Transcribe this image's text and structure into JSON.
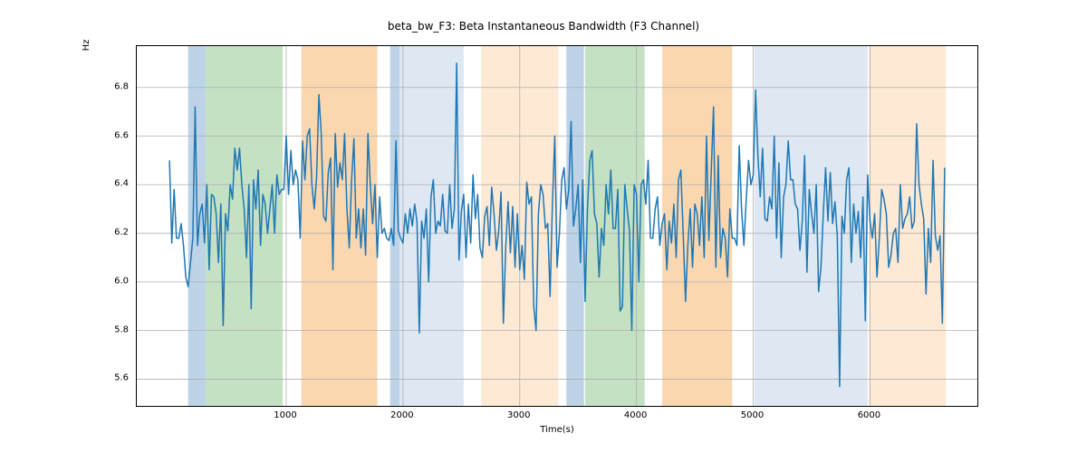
{
  "chart_data": {
    "type": "line",
    "title": "beta_bw_F3: Beta Instantaneous Bandwidth (F3 Channel)",
    "xlabel": "Time(s)",
    "ylabel": "Hz",
    "xlim": [
      -280,
      6920
    ],
    "ylim": [
      5.49,
      6.97
    ],
    "xticks": [
      1000,
      2000,
      3000,
      4000,
      5000,
      6000
    ],
    "yticks": [
      5.6,
      5.8,
      6.0,
      6.2,
      6.4,
      6.6,
      6.8
    ],
    "spans": [
      {
        "x0": 160,
        "x1": 310,
        "color": "#bcd3e8"
      },
      {
        "x0": 310,
        "x1": 970,
        "color": "#c4e1c4"
      },
      {
        "x0": 1130,
        "x1": 1780,
        "color": "#fbd7b0"
      },
      {
        "x0": 1890,
        "x1": 1970,
        "color": "#bcd3e8"
      },
      {
        "x0": 1970,
        "x1": 2520,
        "color": "#dde8f3"
      },
      {
        "x0": 2670,
        "x1": 3330,
        "color": "#fde9d4"
      },
      {
        "x0": 3400,
        "x1": 3550,
        "color": "#bcd3e8"
      },
      {
        "x0": 3560,
        "x1": 4070,
        "color": "#c4e1c4"
      },
      {
        "x0": 4220,
        "x1": 4820,
        "color": "#fbd7b0"
      },
      {
        "x0": 5010,
        "x1": 5980,
        "color": "#dde8f3"
      },
      {
        "x0": 5990,
        "x1": 6650,
        "color": "#fde9d4"
      }
    ],
    "line_color": "#1f77b4",
    "x": [
      0,
      20,
      40,
      60,
      80,
      100,
      120,
      140,
      160,
      180,
      200,
      220,
      240,
      260,
      280,
      300,
      320,
      340,
      360,
      380,
      400,
      420,
      440,
      460,
      480,
      500,
      520,
      540,
      560,
      580,
      600,
      620,
      640,
      660,
      680,
      700,
      720,
      740,
      760,
      780,
      800,
      820,
      840,
      860,
      880,
      900,
      920,
      940,
      960,
      980,
      1000,
      1020,
      1040,
      1060,
      1080,
      1100,
      1120,
      1140,
      1160,
      1180,
      1200,
      1220,
      1240,
      1260,
      1280,
      1300,
      1320,
      1340,
      1360,
      1380,
      1400,
      1420,
      1440,
      1460,
      1480,
      1500,
      1520,
      1540,
      1560,
      1580,
      1600,
      1620,
      1640,
      1660,
      1680,
      1700,
      1720,
      1740,
      1760,
      1780,
      1800,
      1820,
      1840,
      1860,
      1880,
      1900,
      1920,
      1940,
      1960,
      1980,
      2000,
      2020,
      2040,
      2060,
      2080,
      2100,
      2120,
      2140,
      2160,
      2180,
      2200,
      2220,
      2240,
      2260,
      2280,
      2300,
      2320,
      2340,
      2360,
      2380,
      2400,
      2420,
      2440,
      2460,
      2480,
      2500,
      2520,
      2540,
      2560,
      2580,
      2600,
      2620,
      2640,
      2660,
      2680,
      2700,
      2720,
      2740,
      2760,
      2780,
      2800,
      2820,
      2840,
      2860,
      2880,
      2900,
      2920,
      2940,
      2960,
      2980,
      3000,
      3020,
      3040,
      3060,
      3080,
      3100,
      3120,
      3140,
      3160,
      3180,
      3200,
      3220,
      3240,
      3260,
      3280,
      3300,
      3320,
      3340,
      3360,
      3380,
      3400,
      3420,
      3440,
      3460,
      3480,
      3500,
      3520,
      3540,
      3560,
      3580,
      3600,
      3620,
      3640,
      3660,
      3680,
      3700,
      3720,
      3740,
      3760,
      3780,
      3800,
      3820,
      3840,
      3860,
      3880,
      3900,
      3920,
      3940,
      3960,
      3980,
      4000,
      4020,
      4040,
      4060,
      4080,
      4100,
      4120,
      4140,
      4160,
      4180,
      4200,
      4220,
      4240,
      4260,
      4280,
      4300,
      4320,
      4340,
      4360,
      4380,
      4400,
      4420,
      4440,
      4460,
      4480,
      4500,
      4520,
      4540,
      4560,
      4580,
      4600,
      4620,
      4640,
      4660,
      4680,
      4700,
      4720,
      4740,
      4760,
      4780,
      4800,
      4820,
      4840,
      4860,
      4880,
      4900,
      4920,
      4940,
      4960,
      4980,
      5000,
      5020,
      5040,
      5060,
      5080,
      5100,
      5120,
      5140,
      5160,
      5180,
      5200,
      5220,
      5240,
      5260,
      5280,
      5300,
      5320,
      5340,
      5360,
      5380,
      5400,
      5420,
      5440,
      5460,
      5480,
      5500,
      5520,
      5540,
      5560,
      5580,
      5600,
      5620,
      5640,
      5660,
      5680,
      5700,
      5720,
      5740,
      5760,
      5780,
      5800,
      5820,
      5840,
      5860,
      5880,
      5900,
      5920,
      5940,
      5960,
      5980,
      6000,
      6020,
      6040,
      6060,
      6080,
      6100,
      6120,
      6140,
      6160,
      6180,
      6200,
      6220,
      6240,
      6260,
      6280,
      6300,
      6320,
      6340,
      6360,
      6380,
      6400,
      6420,
      6440,
      6460,
      6480,
      6500,
      6520,
      6540,
      6560,
      6580,
      6600,
      6620,
      6640
    ],
    "y": [
      6.5,
      6.16,
      6.38,
      6.18,
      6.18,
      6.24,
      6.15,
      6.02,
      5.98,
      6.08,
      6.18,
      6.72,
      6.15,
      6.28,
      6.32,
      6.16,
      6.4,
      6.05,
      6.36,
      6.35,
      6.28,
      6.08,
      6.32,
      5.82,
      6.28,
      6.21,
      6.4,
      6.34,
      6.55,
      6.46,
      6.55,
      6.4,
      6.3,
      6.1,
      6.4,
      5.89,
      6.42,
      6.3,
      6.46,
      6.15,
      6.36,
      6.32,
      6.2,
      6.3,
      6.4,
      6.2,
      6.44,
      6.36,
      6.38,
      6.38,
      6.6,
      6.36,
      6.54,
      6.4,
      6.46,
      6.42,
      6.18,
      6.58,
      6.42,
      6.6,
      6.63,
      6.4,
      6.3,
      6.43,
      6.77,
      6.61,
      6.27,
      6.25,
      6.45,
      6.51,
      6.05,
      6.61,
      6.39,
      6.49,
      6.42,
      6.61,
      6.3,
      6.14,
      6.42,
      6.59,
      6.18,
      6.3,
      6.14,
      6.3,
      6.11,
      6.61,
      6.4,
      6.24,
      6.4,
      6.1,
      6.35,
      6.2,
      6.22,
      6.18,
      6.17,
      6.22,
      6.15,
      6.58,
      6.21,
      6.18,
      6.16,
      6.28,
      6.2,
      6.3,
      6.23,
      6.32,
      6.25,
      5.79,
      6.25,
      6.18,
      6.3,
      6.0,
      6.35,
      6.42,
      6.2,
      6.25,
      6.23,
      6.36,
      6.21,
      6.2,
      6.4,
      6.22,
      6.3,
      6.9,
      6.09,
      6.29,
      6.36,
      6.1,
      6.32,
      6.16,
      6.44,
      6.26,
      6.36,
      6.14,
      6.1,
      6.27,
      6.31,
      6.15,
      6.39,
      6.28,
      6.13,
      6.21,
      6.37,
      5.83,
      6.14,
      6.33,
      6.12,
      6.31,
      6.06,
      6.28,
      6.05,
      6.15,
      6.01,
      6.41,
      6.32,
      6.35,
      5.9,
      5.8,
      6.28,
      6.4,
      6.36,
      6.22,
      6.24,
      5.94,
      6.32,
      6.6,
      6.06,
      6.2,
      6.42,
      6.47,
      6.3,
      6.38,
      6.66,
      6.23,
      6.3,
      6.4,
      6.08,
      6.42,
      5.92,
      6.3,
      6.5,
      6.54,
      6.28,
      6.24,
      6.02,
      6.22,
      6.15,
      6.4,
      6.28,
      6.46,
      6.22,
      6.22,
      6.38,
      5.88,
      5.9,
      6.4,
      6.3,
      6.21,
      5.8,
      6.4,
      6.36,
      6.0,
      6.4,
      6.42,
      6.32,
      6.5,
      6.18,
      6.18,
      6.3,
      6.35,
      6.15,
      6.24,
      6.28,
      6.05,
      6.25,
      6.16,
      6.32,
      6.1,
      6.42,
      6.46,
      6.2,
      5.92,
      6.15,
      6.3,
      6.06,
      6.32,
      6.28,
      6.15,
      6.35,
      6.1,
      6.6,
      6.17,
      6.45,
      6.72,
      6.06,
      6.52,
      6.1,
      6.22,
      6.18,
      6.02,
      6.3,
      6.18,
      6.18,
      6.15,
      6.56,
      6.3,
      6.15,
      6.34,
      6.5,
      6.4,
      6.44,
      6.79,
      6.52,
      6.35,
      6.55,
      6.26,
      6.25,
      6.35,
      6.3,
      6.6,
      6.18,
      6.49,
      6.1,
      6.35,
      6.4,
      6.58,
      6.42,
      6.42,
      6.32,
      6.3,
      6.13,
      6.25,
      6.52,
      6.04,
      6.38,
      6.28,
      6.2,
      6.4,
      5.96,
      6.06,
      6.28,
      6.47,
      6.25,
      6.45,
      6.24,
      6.33,
      6.19,
      5.57,
      6.27,
      6.2,
      6.42,
      6.47,
      6.08,
      6.32,
      6.2,
      6.29,
      6.1,
      6.35,
      5.84,
      6.44,
      6.25,
      6.18,
      6.28,
      6.02,
      6.18,
      6.38,
      6.34,
      6.28,
      6.06,
      6.11,
      6.2,
      6.22,
      6.08,
      6.4,
      6.22,
      6.26,
      6.28,
      6.35,
      6.22,
      6.25,
      6.65,
      6.4,
      6.32,
      6.26,
      5.95,
      6.22,
      6.08,
      6.5,
      6.19,
      6.13,
      6.19,
      5.83,
      6.47
    ]
  }
}
